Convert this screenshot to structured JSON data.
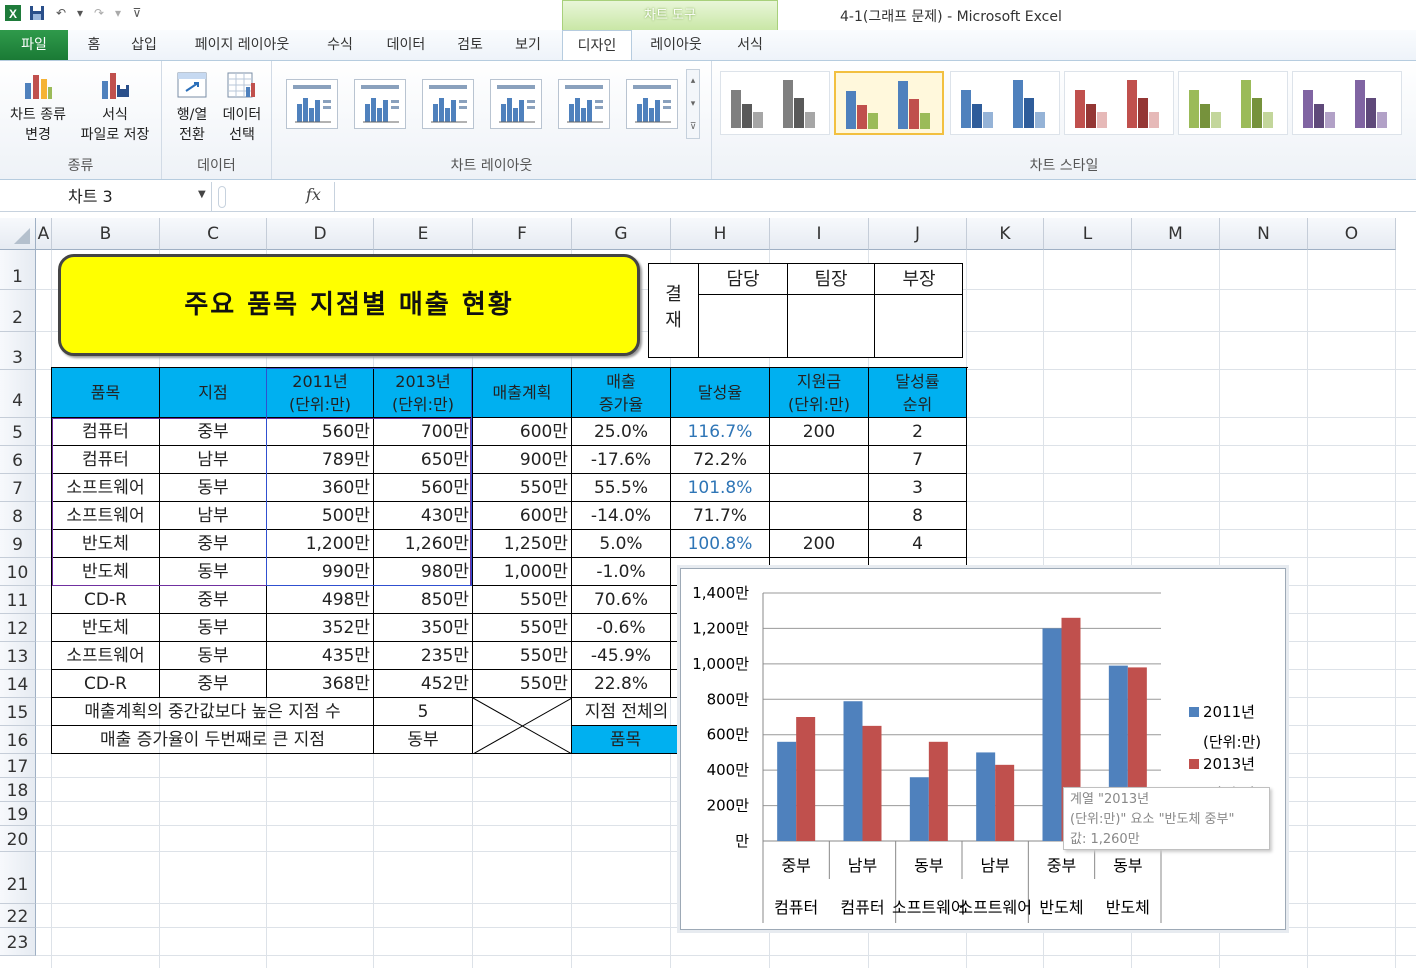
{
  "window": {
    "title": "4-1(그래프 문제)  -  Microsoft Excel",
    "context_tab": "차트 도구"
  },
  "ribbon_tabs": [
    "파일",
    "홈",
    "삽입",
    "페이지 레이아웃",
    "수식",
    "데이터",
    "검토",
    "보기",
    "디자인",
    "레이아웃",
    "서식"
  ],
  "ribbon": {
    "groups": {
      "type": "종류",
      "data": "데이터",
      "layouts": "차트 레이아웃",
      "styles": "차트 스타일"
    },
    "buttons": {
      "change_type": [
        "차트 종류",
        "변경"
      ],
      "save_template": [
        "서식",
        "파일로 저장"
      ],
      "switch_row_col": [
        "행/열",
        "전환"
      ],
      "select_data": [
        "데이터",
        "선택"
      ]
    },
    "style_colors": [
      [
        "#7f7f7f",
        "#595959",
        "#a6a6a6"
      ],
      [
        "#4f81bd",
        "#c0504d",
        "#9bbb59"
      ],
      [
        "#4f81bd",
        "#2e5c9a",
        "#95b3d7"
      ],
      [
        "#c0504d",
        "#943634",
        "#e6b9b8"
      ],
      [
        "#9bbb59",
        "#76923c",
        "#c3d69b"
      ],
      [
        "#8064a2",
        "#5f497a",
        "#b2a1c7"
      ]
    ]
  },
  "namebox": "차트 3",
  "formula": "",
  "columns": [
    "A",
    "B",
    "C",
    "D",
    "E",
    "F",
    "G",
    "H",
    "I",
    "J",
    "K",
    "L",
    "M",
    "N",
    "O"
  ],
  "rows": [
    "1",
    "2",
    "3",
    "4",
    "5",
    "6",
    "7",
    "8",
    "9",
    "10",
    "11",
    "12",
    "13",
    "14",
    "15",
    "16",
    "17",
    "18",
    "19",
    "20",
    "21",
    "22",
    "23"
  ],
  "sheet": {
    "title": "주요 품목 지점별 매출 현황",
    "approval": {
      "label": [
        "결",
        "재"
      ],
      "headers": [
        "담당",
        "팀장",
        "부장"
      ]
    },
    "headers": [
      [
        "품목"
      ],
      [
        "지점"
      ],
      [
        "2011년",
        "(단위:만)"
      ],
      [
        "2013년",
        "(단위:만)"
      ],
      [
        "매출계획"
      ],
      [
        "매출",
        "증가율"
      ],
      [
        "달성율"
      ],
      [
        "지원금",
        "(단위:만)"
      ],
      [
        "달성률",
        "순위"
      ]
    ],
    "data_rows": [
      [
        "컴퓨터",
        "중부",
        "560만",
        "700만",
        "600만",
        "25.0%",
        "116.7%",
        "200",
        "2"
      ],
      [
        "컴퓨터",
        "남부",
        "789만",
        "650만",
        "900만",
        "-17.6%",
        "72.2%",
        "",
        "7"
      ],
      [
        "소프트웨어",
        "동부",
        "360만",
        "560만",
        "550만",
        "55.5%",
        "101.8%",
        "",
        "3"
      ],
      [
        "소프트웨어",
        "남부",
        "500만",
        "430만",
        "600만",
        "-14.0%",
        "71.7%",
        "",
        "8"
      ],
      [
        "반도체",
        "중부",
        "1,200만",
        "1,260만",
        "1,250만",
        "5.0%",
        "100.8%",
        "200",
        "4"
      ],
      [
        "반도체",
        "동부",
        "990만",
        "980만",
        "1,000만",
        "-1.0%",
        "",
        "",
        ""
      ],
      [
        "CD-R",
        "중부",
        "498만",
        "850만",
        "550만",
        "70.6%",
        "",
        "",
        ""
      ],
      [
        "반도체",
        "동부",
        "352만",
        "350만",
        "550만",
        "-0.6%",
        "",
        "",
        ""
      ],
      [
        "소프트웨어",
        "동부",
        "435만",
        "235만",
        "550만",
        "-45.9%",
        "",
        "",
        ""
      ],
      [
        "CD-R",
        "중부",
        "368만",
        "452만",
        "550만",
        "22.8%",
        "",
        "",
        ""
      ]
    ],
    "row15_label": "매출계획의 중간값보다 높은 지점 수",
    "row15_value": "5",
    "row15_g": "지점 전체의",
    "row16_label": "매출 증가율이 두번째로 큰 지점",
    "row16_value": "동부",
    "row16_g": "품목"
  },
  "chart_data": {
    "type": "bar",
    "categories": [
      [
        "중부",
        "컴퓨터"
      ],
      [
        "남부",
        "컴퓨터"
      ],
      [
        "동부",
        "소프트웨어"
      ],
      [
        "남부",
        "소프트웨어"
      ],
      [
        "중부",
        "반도체"
      ],
      [
        "동부",
        "반도체"
      ]
    ],
    "group_labels": [
      "컴퓨터",
      "컴퓨터",
      "소프트웨어",
      "소프트웨어",
      "반도체",
      "반도체"
    ],
    "sub_labels": [
      "중부",
      "남부",
      "동부",
      "남부",
      "중부",
      "동부"
    ],
    "series": [
      {
        "name": "2011년 (단위:만)",
        "legend_lines": [
          "2011년",
          "(단위:만)"
        ],
        "color": "#4f81bd",
        "values": [
          560,
          789,
          360,
          500,
          1200,
          990
        ]
      },
      {
        "name": "2013년 (단위:만)",
        "legend_lines": [
          "2013년",
          "(단위:만)"
        ],
        "color": "#c0504d",
        "values": [
          700,
          650,
          560,
          430,
          1260,
          980
        ]
      }
    ],
    "ylim": [
      0,
      1400
    ],
    "yticks": [
      "만",
      "200만",
      "400만",
      "600만",
      "800만",
      "1,000만",
      "1,200만",
      "1,400만"
    ],
    "grid": true,
    "legend_position": "right"
  },
  "tooltip": [
    "계열 \"2013년",
    "(단위:만)\" 요소 \"반도체 중부\"",
    "값: 1,260만"
  ]
}
